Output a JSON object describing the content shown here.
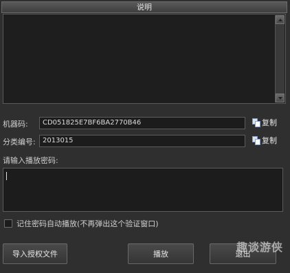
{
  "description": {
    "header": "说明",
    "content": ""
  },
  "machine_code": {
    "label": "机器码:",
    "value": "CD051825E7BF6BA2770B46",
    "copy_label": "复制"
  },
  "category": {
    "label": "分类编号:",
    "value": "2013015",
    "copy_label": "复制"
  },
  "password": {
    "label": "请输入播放密码:",
    "value": ""
  },
  "remember": {
    "label": "记住密码自动播放(不再弹出这个验证窗口)",
    "checked": false
  },
  "buttons": {
    "import_license": "导入授权文件",
    "play": "播放",
    "exit": "退出"
  },
  "watermark": "趣谈游侠",
  "icons": {
    "copy": "copy-icon",
    "scroll_up": "scroll-up-icon",
    "scroll_down": "scroll-down-icon"
  }
}
